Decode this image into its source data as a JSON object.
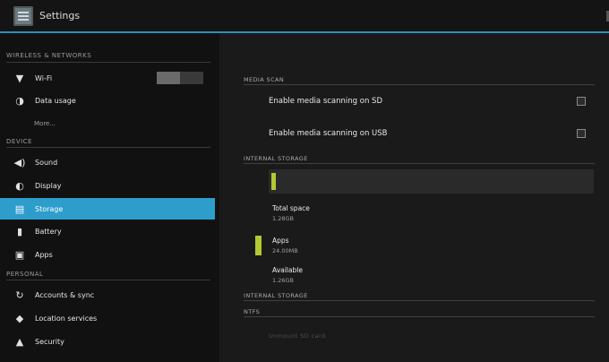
{
  "actionbar": {
    "title": "Settings",
    "icon": "settings-icon"
  },
  "colors": {
    "accent": "#2d9dcc",
    "apps_bar": "#b3c832"
  },
  "sidebar": {
    "sections": [
      {
        "label": "Wireless & networks"
      },
      {
        "label": "Device"
      },
      {
        "label": "Personal"
      }
    ],
    "items": [
      {
        "label": "Wi-Fi",
        "icon": "wifi-icon"
      },
      {
        "label": "Data usage",
        "icon": "data-usage-icon"
      },
      {
        "label": "More..."
      },
      {
        "label": "Sound",
        "icon": "sound-icon"
      },
      {
        "label": "Display",
        "icon": "display-icon"
      },
      {
        "label": "Storage",
        "icon": "storage-icon"
      },
      {
        "label": "Battery",
        "icon": "battery-icon"
      },
      {
        "label": "Apps",
        "icon": "apps-icon"
      },
      {
        "label": "Accounts & sync",
        "icon": "sync-icon"
      },
      {
        "label": "Location services",
        "icon": "location-icon"
      },
      {
        "label": "Security",
        "icon": "lock-icon"
      }
    ]
  },
  "main": {
    "media_section": "Media scan",
    "prefs": [
      {
        "title": "Enable media scanning on SD"
      },
      {
        "title": "Enable media scanning on USB"
      }
    ],
    "internal_section": "Internal storage",
    "storage_bar": {
      "apps_fraction": 0.015
    },
    "legend": [
      {
        "name": "Total space",
        "size": "1.28GB"
      },
      {
        "name": "Apps",
        "size": "24.00MB"
      },
      {
        "name": "Available",
        "size": "1.26GB"
      }
    ],
    "storage_section_2": "Internal storage",
    "bottom_label": "NTFS",
    "bottom_item": "Unmount SD card"
  }
}
